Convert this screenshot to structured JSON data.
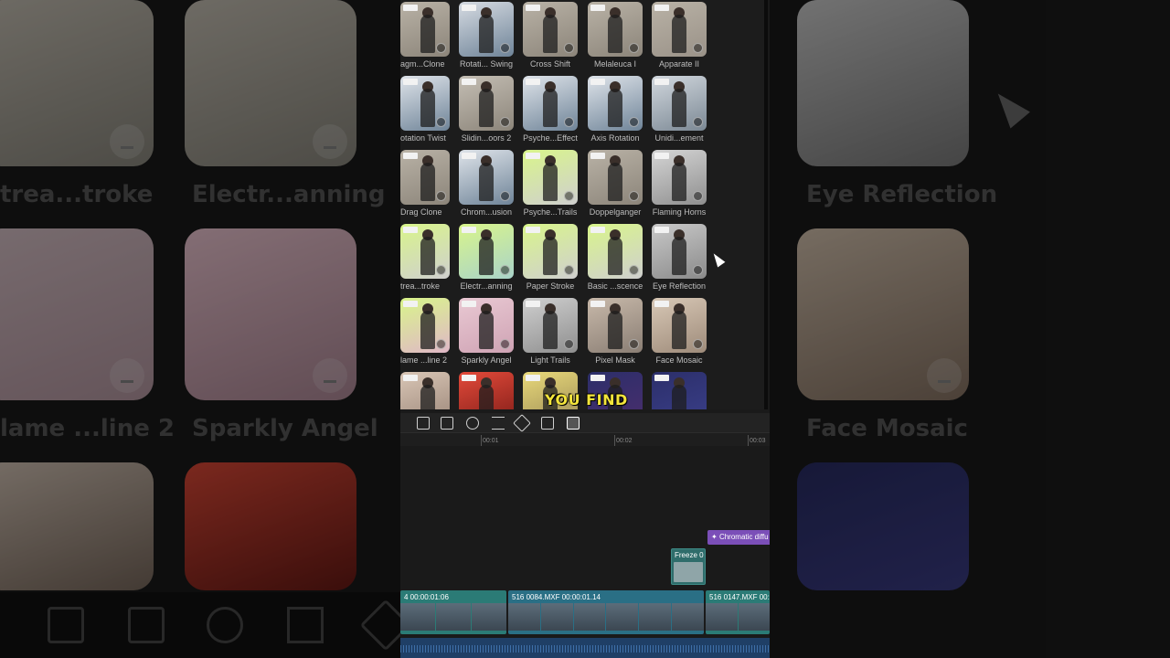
{
  "caption": "YOU FIND",
  "effects": [
    {
      "label": "agm...Clone",
      "colors": [
        "#b9b2a6",
        "#8c857a"
      ]
    },
    {
      "label": "Rotati... Swing",
      "colors": [
        "#d6dbe2",
        "#6f8498"
      ]
    },
    {
      "label": "Cross Shift",
      "colors": [
        "#b9b2a6",
        "#8c857a"
      ]
    },
    {
      "label": "Melaleuca I",
      "colors": [
        "#b9b2a6",
        "#8c857a"
      ]
    },
    {
      "label": "Apparate II",
      "colors": [
        "#b9b2a6",
        "#9a9288"
      ]
    },
    {
      "label": "otation Twist",
      "colors": [
        "#dfe4ea",
        "#6f8498"
      ]
    },
    {
      "label": "Slidin...oors 2",
      "colors": [
        "#c4beb4",
        "#8c857a"
      ]
    },
    {
      "label": "Psyche...Effect",
      "colors": [
        "#dfe4ea",
        "#6f8498"
      ]
    },
    {
      "label": "Axis Rotation",
      "colors": [
        "#dfe4ea",
        "#6f8498"
      ]
    },
    {
      "label": "Unidi...ement",
      "colors": [
        "#d2d8de",
        "#7b8894"
      ]
    },
    {
      "label": "Drag Clone",
      "colors": [
        "#b9b2a6",
        "#8c857a"
      ]
    },
    {
      "label": "Chrom...usion",
      "colors": [
        "#dfe4ea",
        "#6f8498"
      ]
    },
    {
      "label": "Psyche...Trails",
      "colors": [
        "#d9f58a",
        "#cfcfcf"
      ]
    },
    {
      "label": "Doppelganger",
      "colors": [
        "#b9b2a6",
        "#8c857a"
      ]
    },
    {
      "label": "Flaming Horns",
      "colors": [
        "#d5d5d5",
        "#8f8f8f"
      ]
    },
    {
      "label": "trea...troke",
      "colors": [
        "#d9f58a",
        "#cfcfcf"
      ]
    },
    {
      "label": "Electr...anning",
      "colors": [
        "#d9f58a",
        "#a9d3c9"
      ]
    },
    {
      "label": "Paper Stroke",
      "colors": [
        "#d9f58a",
        "#cfcfcf"
      ]
    },
    {
      "label": "Basic ...scence",
      "colors": [
        "#d9f58a",
        "#cfcfcf"
      ]
    },
    {
      "label": "Eye Reflection",
      "colors": [
        "#c9c9c9",
        "#8a8a8a"
      ]
    },
    {
      "label": "lame ...line 2",
      "colors": [
        "#d9f58a",
        "#e0b7c7"
      ]
    },
    {
      "label": "Sparkly Angel",
      "colors": [
        "#e9c9d3",
        "#cfa3b4"
      ]
    },
    {
      "label": "Light Trails",
      "colors": [
        "#cfcfcf",
        "#8f8f8f"
      ]
    },
    {
      "label": "Pixel Mask",
      "colors": [
        "#c8b9aa",
        "#8a7e74"
      ]
    },
    {
      "label": "Face Mosaic",
      "colors": [
        "#d8c8b6",
        "#9e8b7a"
      ]
    },
    {
      "label": "",
      "colors": [
        "#d9c6b6",
        "#9a8577"
      ]
    },
    {
      "label": "",
      "colors": [
        "#e34a3a",
        "#7e1c17"
      ]
    },
    {
      "label": "",
      "colors": [
        "#e9d97a",
        "#9a8a55"
      ]
    },
    {
      "label": "",
      "colors": [
        "#2c2f6a",
        "#4b2d6d"
      ]
    },
    {
      "label": "",
      "colors": [
        "#2c2f6a",
        "#3a3f8a"
      ]
    }
  ],
  "bg_left": {
    "labels": [
      "trea...troke",
      "Electr...anning",
      "lame ...line 2",
      "Sparkly Angel"
    ]
  },
  "bg_right": {
    "labels": [
      "Eye Reflection",
      "Face Mosaic"
    ]
  },
  "toolbar": {
    "icons": [
      "delete-icon",
      "split-icon",
      "speed-icon",
      "mirror-icon",
      "rotate-icon",
      "crop-icon",
      "freeze-frame-icon"
    ]
  },
  "ruler": {
    "ticks": [
      "00:01",
      "00:02",
      "00:03"
    ]
  },
  "timeline": {
    "effect_clip": "Chromatic diffu",
    "freeze_clip": "Freeze",
    "freeze_suffix": "0",
    "clips": [
      {
        "label": "4  00:00:01:06",
        "color": "#2b7b76"
      },
      {
        "label": "516 0084.MXF  00:00:01.14",
        "color": "#2a6f85"
      },
      {
        "label": "516 0147.MXF  00:",
        "color": "#2b7b76"
      }
    ]
  }
}
